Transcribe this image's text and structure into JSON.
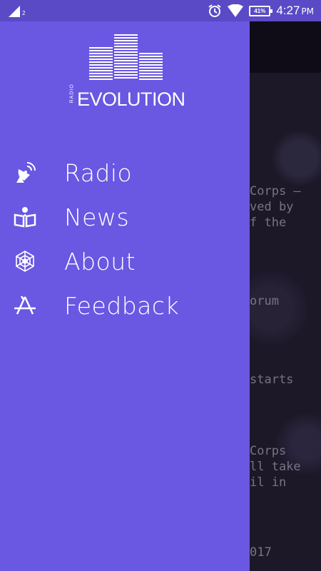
{
  "status_bar": {
    "signal_sub": "2",
    "battery": "41%",
    "time": "4:27",
    "ampm": "PM"
  },
  "app": {
    "logo_small": "RADIO",
    "logo_word": "EVOLUTION"
  },
  "menu": {
    "items": [
      {
        "label": "Radio",
        "icon": "satellite-dish-icon"
      },
      {
        "label": "News",
        "icon": "reading-person-icon"
      },
      {
        "label": "About",
        "icon": "spider-web-icon"
      },
      {
        "label": "Feedback",
        "icon": "app-store-icon"
      }
    ]
  },
  "background_text": [
    "Corps –",
    "ved by",
    "f the",
    "orum",
    "starts",
    "Corps",
    "ll take",
    "il in",
    "017"
  ],
  "colors": {
    "drawer": "#6a57e2",
    "status_bar": "#5a4ac6",
    "background": "#201b31"
  }
}
